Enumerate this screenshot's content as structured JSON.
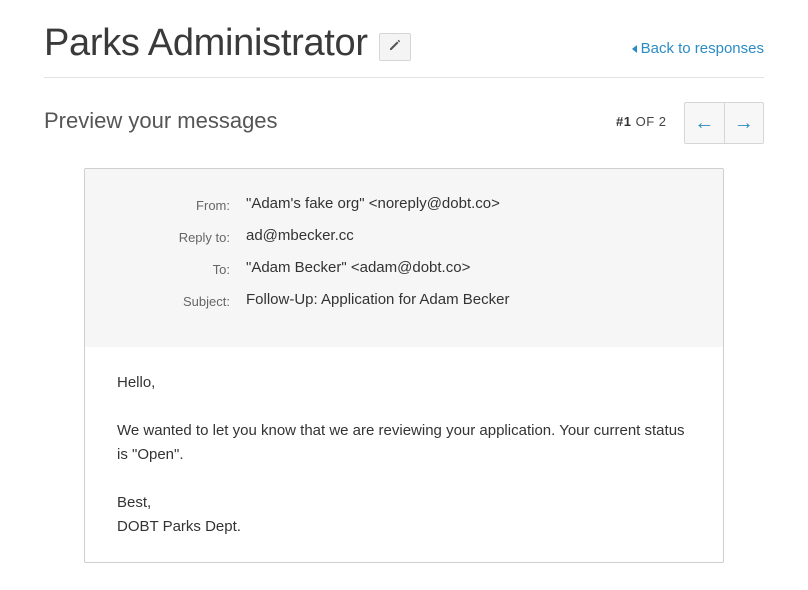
{
  "header": {
    "title": "Parks Administrator",
    "back_link": "Back to responses"
  },
  "preview": {
    "subtitle": "Preview your messages",
    "counter_current": "#1",
    "counter_of": "OF 2",
    "prev_arrow": "←",
    "next_arrow": "→"
  },
  "message": {
    "from_label": "From:",
    "from_value": "\"Adam's fake org\" <noreply@dobt.co>",
    "reply_label": "Reply to:",
    "reply_value": "ad@mbecker.cc",
    "to_label": "To:",
    "to_value": "\"Adam Becker\" <adam@dobt.co>",
    "subject_label": "Subject:",
    "subject_value": "Follow-Up: Application for Adam Becker",
    "greeting": "Hello,",
    "body": "We wanted to let you know that we are reviewing your application. Your current status is \"Open\".",
    "signoff": "Best,",
    "signature": "DOBT Parks Dept."
  },
  "colors": {
    "link": "#2b8cc4",
    "header_bg": "#f6f6f6"
  },
  "icons": {
    "edit": "pencil-icon",
    "back": "caret-left-icon"
  }
}
